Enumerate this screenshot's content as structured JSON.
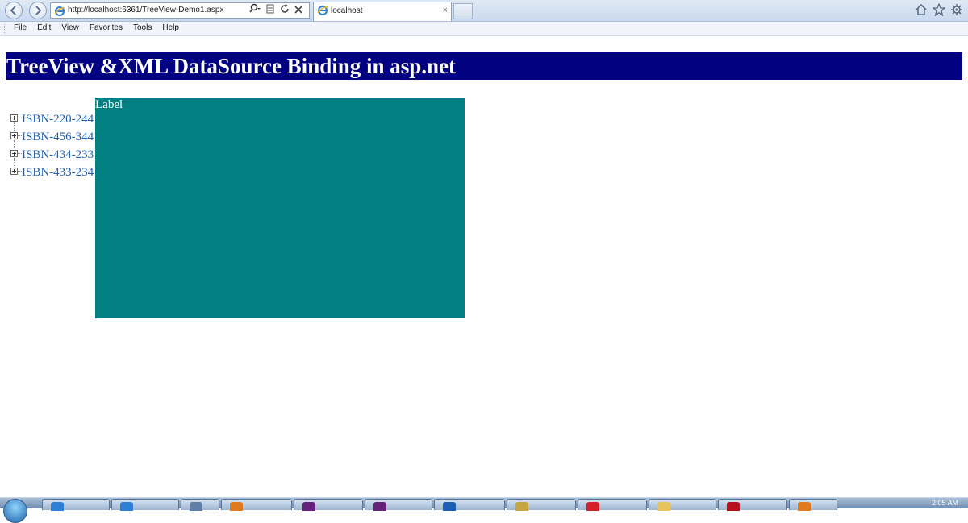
{
  "browser": {
    "address_url": "http://localhost:6361/TreeView-Demo1.aspx",
    "tab_title": "localhost",
    "tab_close": "×",
    "icons": [
      "back-icon",
      "forward-icon",
      "ie-logo-icon",
      "search-icon",
      "compatibility-icon",
      "refresh-icon",
      "stop-icon",
      "home-icon",
      "favorites-star-icon",
      "gear-icon"
    ]
  },
  "menubar": {
    "items": [
      "File",
      "Edit",
      "View",
      "Favorites",
      "Tools",
      "Help"
    ]
  },
  "page": {
    "title": "TreeView &XML DataSource Binding in asp.net",
    "header_color": "#000080",
    "tree": {
      "nodes": [
        "ISBN-220-244",
        "ISBN-456-344",
        "ISBN-434-233",
        "ISBN-433-234"
      ],
      "link_color": "#1c5fb5"
    },
    "label_panel": {
      "text": "Label",
      "background_color": "#008080"
    }
  },
  "taskbar": {
    "clock": "2:05 AM",
    "apps": [
      "internet-explorer-icon",
      "internet-explorer-icon",
      "explorer-icon",
      "firefox-icon",
      "visual-studio-icon",
      "visual-studio-icon",
      "chrome-icon",
      "winrar-icon",
      "acrobat-icon",
      "folder-icon",
      "pdf-icon",
      "firefox-icon"
    ]
  }
}
